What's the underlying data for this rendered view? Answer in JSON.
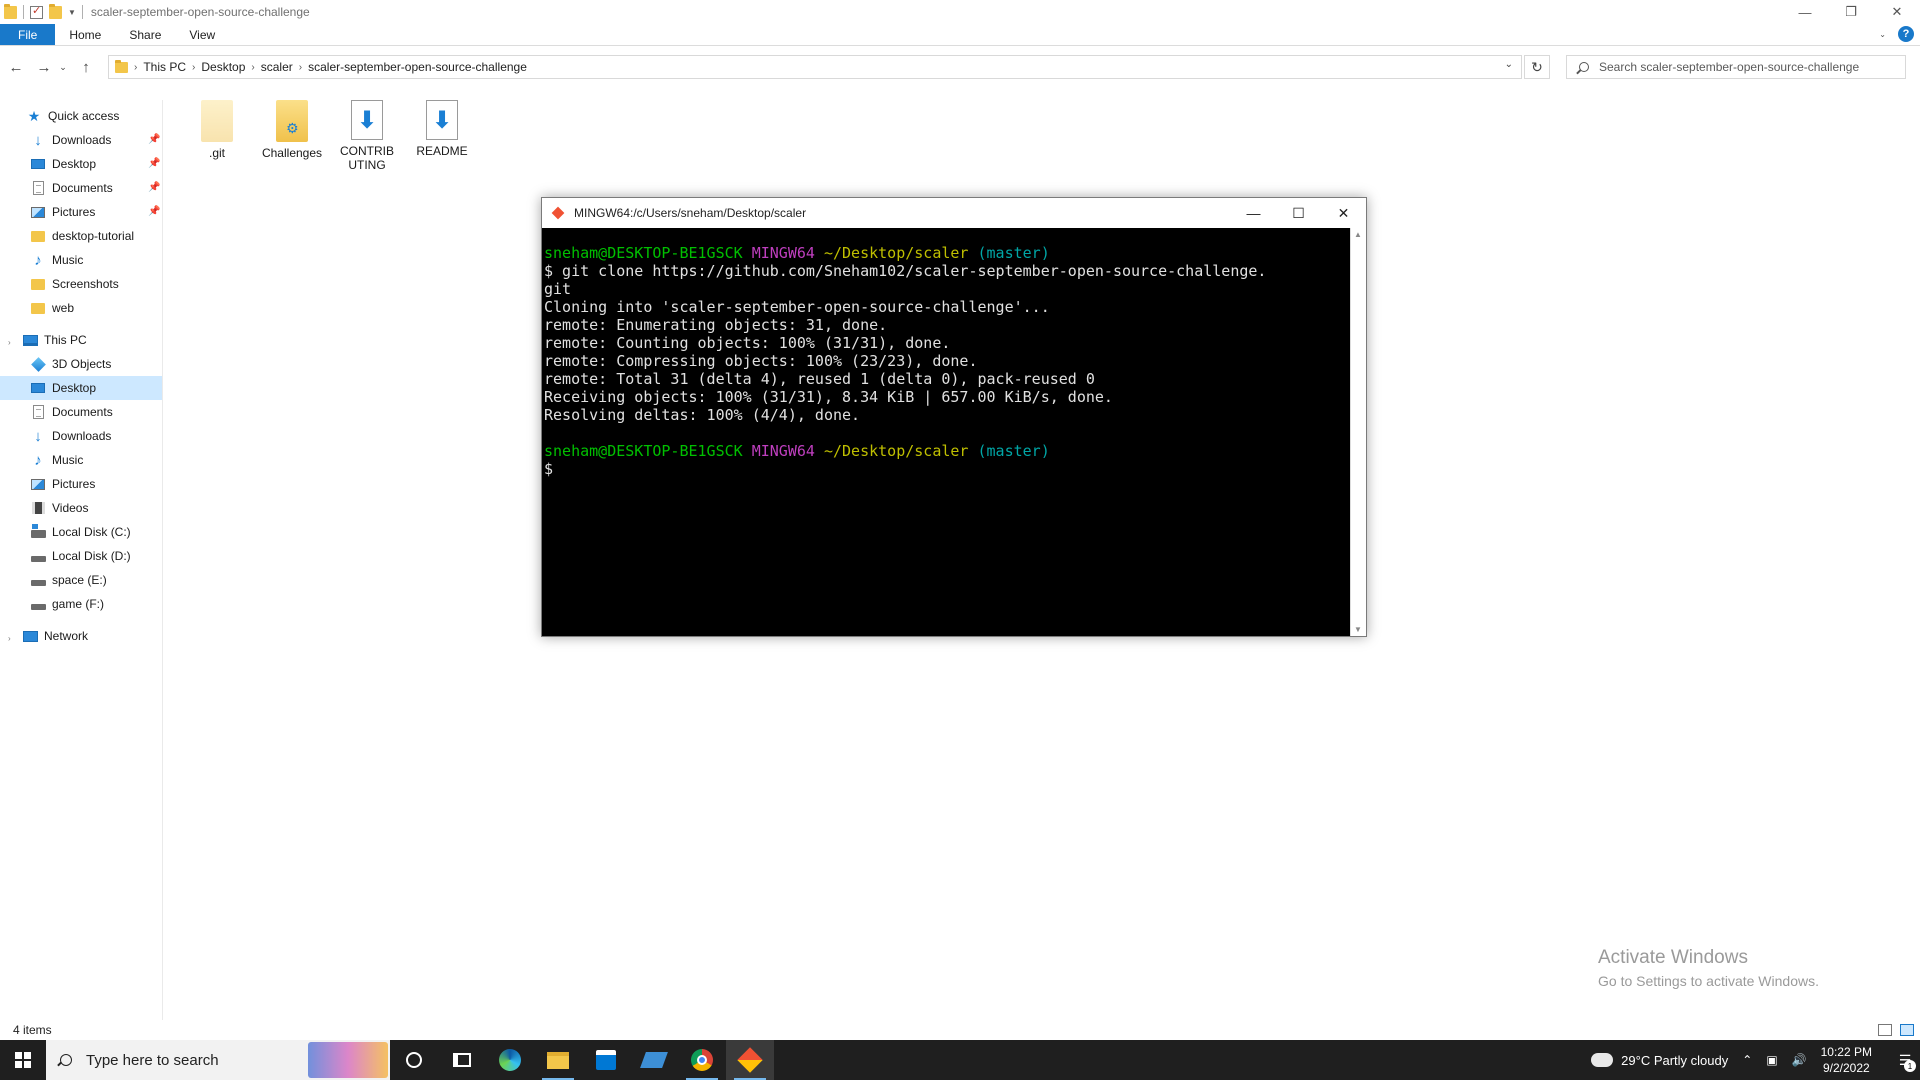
{
  "explorer": {
    "window_title": "scaler-september-open-source-challenge",
    "ribbon_tabs": [
      "File",
      "Home",
      "Share",
      "View"
    ],
    "breadcrumb": [
      "This PC",
      "Desktop",
      "scaler",
      "scaler-september-open-source-challenge"
    ],
    "search_placeholder": "Search scaler-september-open-source-challenge",
    "quick_access": {
      "label": "Quick access",
      "items": [
        {
          "label": "Downloads",
          "icon": "downloads-icon",
          "pinned": true
        },
        {
          "label": "Desktop",
          "icon": "desktop-icon",
          "pinned": true
        },
        {
          "label": "Documents",
          "icon": "documents-icon",
          "pinned": true
        },
        {
          "label": "Pictures",
          "icon": "pictures-icon",
          "pinned": true
        },
        {
          "label": "desktop-tutorial",
          "icon": "folder-icon",
          "pinned": false
        },
        {
          "label": "Music",
          "icon": "music-icon",
          "pinned": false
        },
        {
          "label": "Screenshots",
          "icon": "folder-icon",
          "pinned": false
        },
        {
          "label": "web",
          "icon": "folder-icon",
          "pinned": false
        }
      ]
    },
    "this_pc": {
      "label": "This PC",
      "items": [
        {
          "label": "3D Objects",
          "icon": "3d-objects-icon"
        },
        {
          "label": "Desktop",
          "icon": "desktop-icon",
          "selected": true
        },
        {
          "label": "Documents",
          "icon": "documents-icon"
        },
        {
          "label": "Downloads",
          "icon": "downloads-icon"
        },
        {
          "label": "Music",
          "icon": "music-icon"
        },
        {
          "label": "Pictures",
          "icon": "pictures-icon"
        },
        {
          "label": "Videos",
          "icon": "videos-icon"
        },
        {
          "label": "Local Disk (C:)",
          "icon": "system-disk-icon"
        },
        {
          "label": "Local Disk (D:)",
          "icon": "disk-icon"
        },
        {
          "label": "space (E:)",
          "icon": "disk-icon"
        },
        {
          "label": "game (F:)",
          "icon": "disk-icon"
        }
      ]
    },
    "network_label": "Network",
    "files": [
      {
        "name": ".git",
        "type": "hidden-folder"
      },
      {
        "name": "Challenges",
        "type": "folder"
      },
      {
        "name": "CONTRIBUTING",
        "type": "markdown-file"
      },
      {
        "name": "README",
        "type": "markdown-file"
      }
    ],
    "status": "4 items"
  },
  "terminal": {
    "title": "MINGW64:/c/Users/sneham/Desktop/scaler",
    "prompt_user": "sneham@DESKTOP-BE1GSCK",
    "prompt_env": "MINGW64",
    "prompt_path": "~/Desktop/scaler",
    "prompt_branch": "(master)",
    "command": "$ git clone https://github.com/Sneham102/scaler-september-open-source-challenge.",
    "command_wrap": "git",
    "output": [
      "Cloning into 'scaler-september-open-source-challenge'...",
      "remote: Enumerating objects: 31, done.",
      "remote: Counting objects: 100% (31/31), done.",
      "remote: Compressing objects: 100% (23/23), done.",
      "remote: Total 31 (delta 4), reused 1 (delta 0), pack-reused 0",
      "Receiving objects: 100% (31/31), 8.34 KiB | 657.00 KiB/s, done.",
      "Resolving deltas: 100% (4/4), done."
    ],
    "prompt_symbol": "$"
  },
  "watermark": {
    "line1": "Activate Windows",
    "line2": "Go to Settings to activate Windows."
  },
  "taskbar": {
    "search_placeholder": "Type here to search",
    "weather": "29°C  Partly cloudy",
    "time": "10:22 PM",
    "date": "9/2/2022",
    "notification_count": "1"
  },
  "colors": {
    "accent": "#1979ca",
    "selection": "#cde8ff",
    "terminal_green": "#00c000",
    "terminal_magenta": "#bf3fbf",
    "terminal_yellow": "#bfbf00",
    "terminal_cyan": "#00a6a6"
  }
}
